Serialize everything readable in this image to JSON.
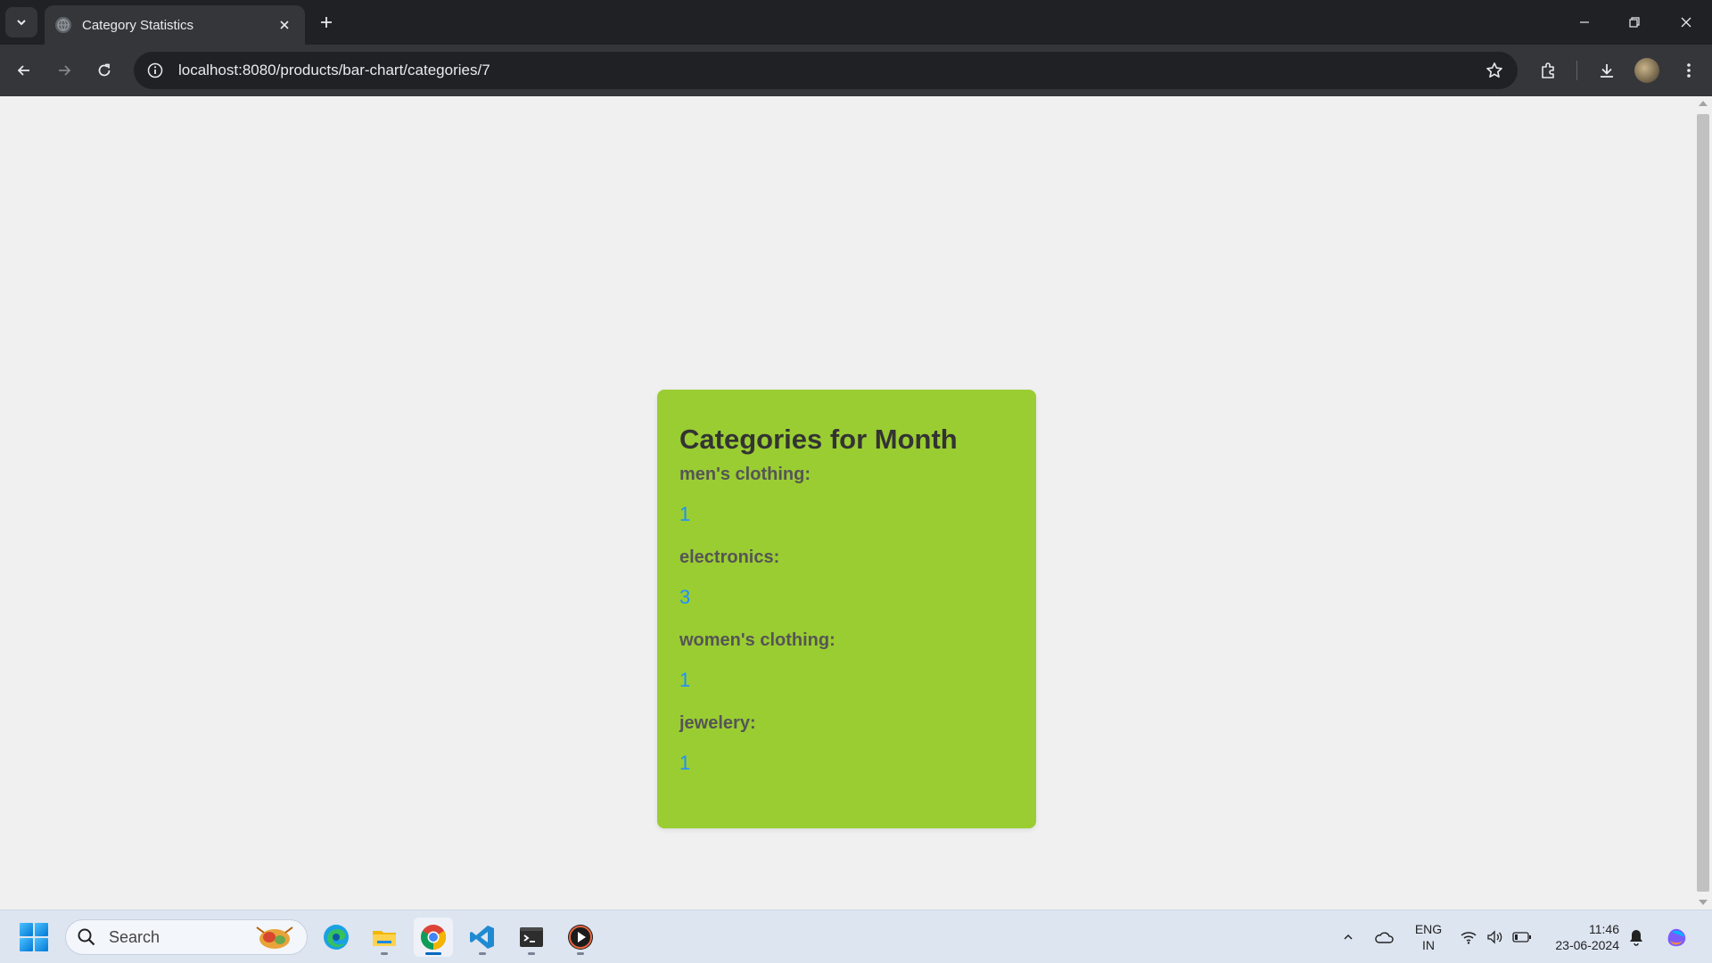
{
  "browser": {
    "tab_title": "Category Statistics",
    "url": "localhost:8080/products/bar-chart/categories/7"
  },
  "page": {
    "title": "Categories for Month",
    "categories": [
      {
        "label": "men's clothing:",
        "value": "1"
      },
      {
        "label": "electronics:",
        "value": "3"
      },
      {
        "label": "women's clothing:",
        "value": "1"
      },
      {
        "label": "jewelery:",
        "value": "1"
      }
    ]
  },
  "taskbar": {
    "search_placeholder": "Search",
    "apps": [
      "edge-icon",
      "file-explorer-icon",
      "chrome-icon",
      "vscode-icon",
      "terminal-icon",
      "media-player-icon"
    ],
    "language_line1": "ENG",
    "language_line2": "IN",
    "time": "11:46",
    "date": "23-06-2024"
  },
  "colors": {
    "card_background": "#9acd32",
    "value_text": "#1e90ff",
    "label_text": "#555555"
  }
}
